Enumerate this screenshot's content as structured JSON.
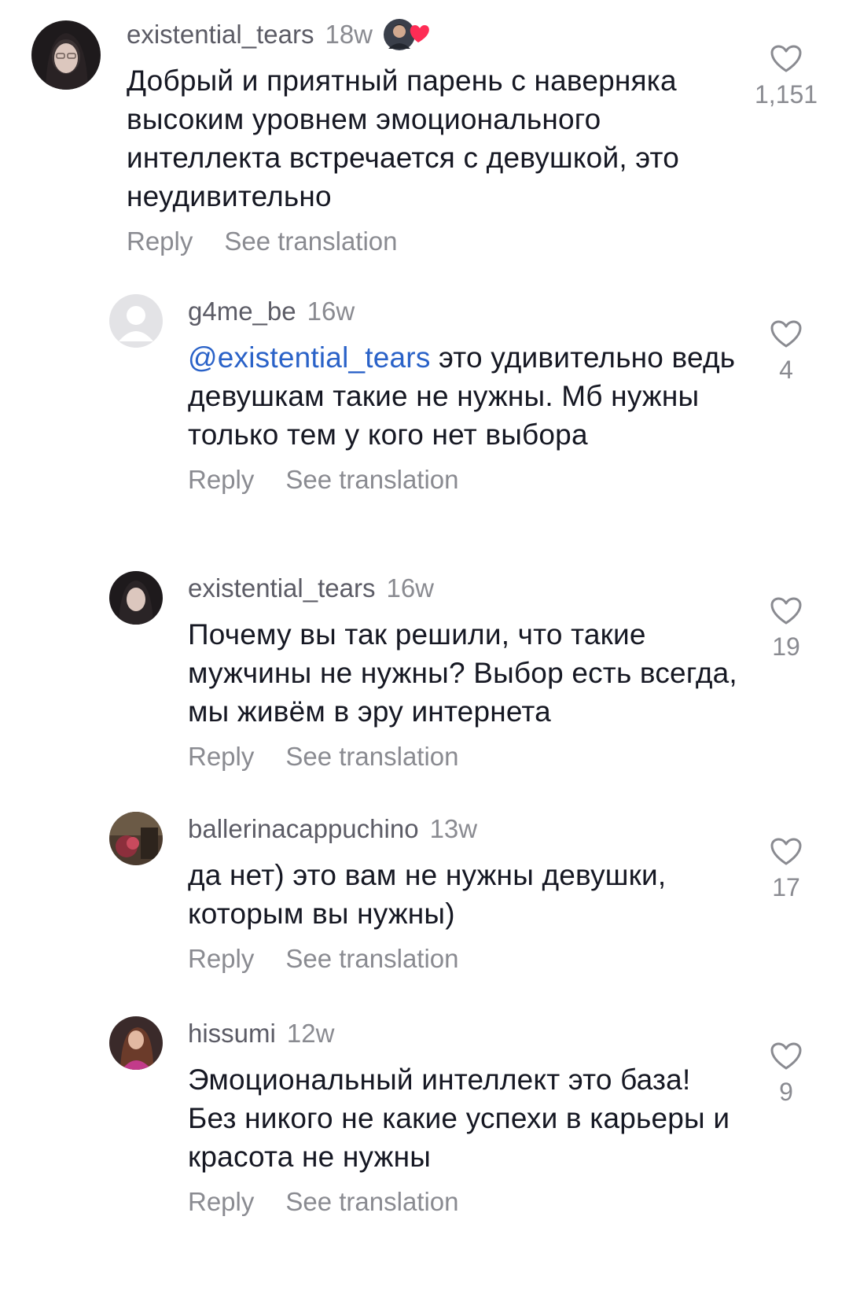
{
  "comments": [
    {
      "username": "existential_tears",
      "age": "18w",
      "text": "Добрый и приятный парень с наверняка высоким уровнем эмоционального интеллекта встречается с девушкой, это неудивительно",
      "likes": "1,151",
      "creator_liked": true
    },
    {
      "username": "g4me_be",
      "age": "16w",
      "mention": "@existential_tears",
      "text": " это удивительно ведь девушкам такие не нужны. Мб нужны только тем у кого нет выбора",
      "likes": "4"
    },
    {
      "username": "existential_tears",
      "age": "16w",
      "text": "Почему вы так решили, что такие мужчины не нужны? Выбор есть всегда, мы живём в эру интернета",
      "likes": "19"
    },
    {
      "username": "ballerinacappuchino",
      "age": "13w",
      "text": "да нет) это вам не нужны девушки, которым вы нужны)",
      "likes": "17"
    },
    {
      "username": "hissumi",
      "age": "12w",
      "text": "Эмоциональный интеллект это база! Без никого не какие успехи в карьеры и красота не нужны",
      "likes": "9"
    }
  ],
  "actions": {
    "reply_label": "Reply",
    "translate_label": "See translation"
  },
  "colors": {
    "text": "#161823",
    "muted": "#8a8b91",
    "mention": "#2a62c8",
    "heart_badge": "#fe2c55"
  }
}
